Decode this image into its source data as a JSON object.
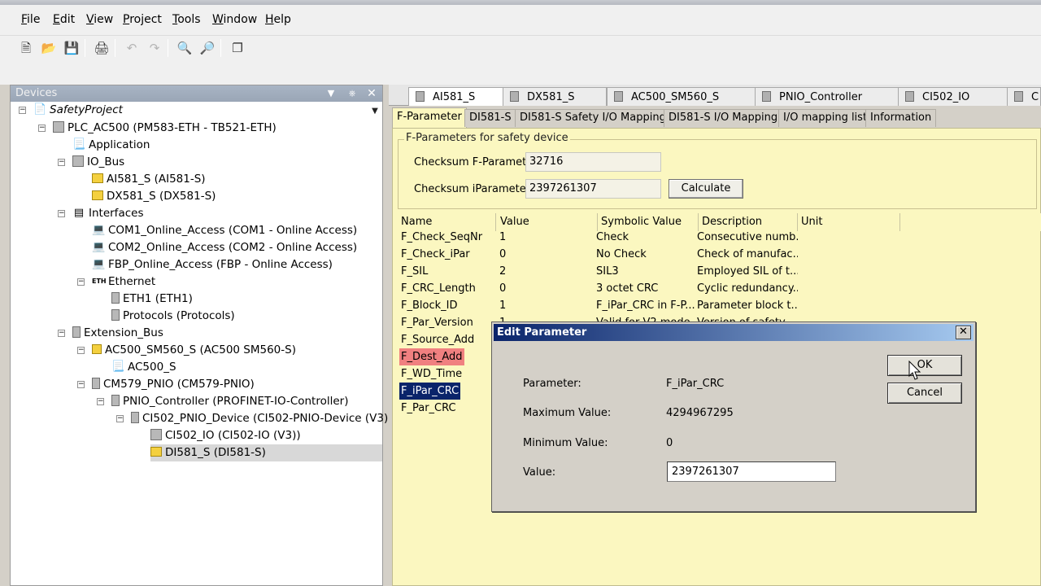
{
  "menu": [
    {
      "pre": "",
      "key": "F",
      "post": "ile"
    },
    {
      "pre": "",
      "key": "E",
      "post": "dit"
    },
    {
      "pre": "",
      "key": "V",
      "post": "iew"
    },
    {
      "pre": "",
      "key": "P",
      "post": "roject"
    },
    {
      "pre": "",
      "key": "T",
      "post": "ools"
    },
    {
      "pre": "",
      "key": "W",
      "post": "indow"
    },
    {
      "pre": "",
      "key": "H",
      "post": "elp"
    }
  ],
  "toolbar_icons": [
    "new-file-icon",
    "open-folder-icon",
    "save-icon",
    "print-icon",
    "undo-icon",
    "redo-icon",
    "find-icon",
    "find-replace-icon",
    "copy-window-icon"
  ],
  "devices": {
    "header": "Devices",
    "tree": [
      {
        "label": "SafetyProject",
        "italic": true
      },
      {
        "label": "PLC_AC500 (PM583-ETH - TB521-ETH)"
      },
      {
        "label": "Application"
      },
      {
        "label": "IO_Bus"
      },
      {
        "label": "AI581_S (AI581-S)"
      },
      {
        "label": "DX581_S (DX581-S)"
      },
      {
        "label": "Interfaces"
      },
      {
        "label": "COM1_Online_Access (COM1 - Online Access)"
      },
      {
        "label": "COM2_Online_Access (COM2 - Online Access)"
      },
      {
        "label": "FBP_Online_Access (FBP - Online Access)"
      },
      {
        "label": "Ethernet"
      },
      {
        "label": "ETH1 (ETH1)"
      },
      {
        "label": "Protocols (Protocols)"
      },
      {
        "label": "Extension_Bus"
      },
      {
        "label": "AC500_SM560_S (AC500 SM560-S)"
      },
      {
        "label": "AC500_S"
      },
      {
        "label": "CM579_PNIO (CM579-PNIO)"
      },
      {
        "label": "PNIO_Controller (PROFINET-IO-Controller)"
      },
      {
        "label": "CI502_PNIO_Device (CI502-PNIO-Device (V3))"
      },
      {
        "label": "CI502_IO (CI502-IO (V3))"
      },
      {
        "label": "DI581_S (DI581-S)",
        "selected": true
      }
    ]
  },
  "device_tabs": [
    "AI581_S",
    "DX581_S",
    "AC500_SM560_S",
    "PNIO_Controller",
    "CI502_IO",
    "C"
  ],
  "sub_tabs": [
    "F-Parameter",
    "DI581-S",
    "DI581-S Safety I/O Mapping",
    "DI581-S I/O Mapping",
    "I/O mapping list",
    "Information"
  ],
  "fparams": {
    "group_title": "F-Parameters for safety device",
    "checksum_f_label": "Checksum F-Parameter:",
    "checksum_f_value": "32716",
    "checksum_i_label": "Checksum iParameter:",
    "checksum_i_value": "2397261307",
    "calculate": "Calculate",
    "columns": [
      "Name",
      "Value",
      "Symbolic Value",
      "Description",
      "Unit"
    ],
    "rows": [
      {
        "name": "F_Check_SeqNr",
        "value": "1",
        "symbolic": "Check",
        "desc": "Consecutive numb..."
      },
      {
        "name": "F_Check_iPar",
        "value": "0",
        "symbolic": "No Check",
        "desc": "Check of manufac..."
      },
      {
        "name": "F_SIL",
        "value": "2",
        "symbolic": "SIL3",
        "desc": "Employed SIL of t..."
      },
      {
        "name": "F_CRC_Length",
        "value": "0",
        "symbolic": "3 octet CRC",
        "desc": "Cyclic redundancy..."
      },
      {
        "name": "F_Block_ID",
        "value": "1",
        "symbolic": "F_iPar_CRC in F-P...",
        "desc": "Parameter block t..."
      },
      {
        "name": "F_Par_Version",
        "value": "1",
        "symbolic": "Valid for V2 mode",
        "desc": "Version of safety..."
      },
      {
        "name": "F_Source_Add",
        "value": "",
        "symbolic": "",
        "desc": ""
      },
      {
        "name": "F_Dest_Add",
        "value": "",
        "symbolic": "",
        "desc": "",
        "highlight": "red"
      },
      {
        "name": "F_WD_Time",
        "value": "",
        "symbolic": "",
        "desc": ""
      },
      {
        "name": "F_iPar_CRC",
        "value": "",
        "symbolic": "",
        "desc": "",
        "highlight": "blue"
      },
      {
        "name": "F_Par_CRC",
        "value": "",
        "symbolic": "",
        "desc": ""
      }
    ]
  },
  "dialog": {
    "title": "Edit Parameter",
    "ok": "OK",
    "cancel": "Cancel",
    "param_label": "Parameter:",
    "param_value": "F_iPar_CRC",
    "max_label": "Maximum Value:",
    "max_value": "4294967295",
    "min_label": "Minimum Value:",
    "min_value": "0",
    "value_label": "Value:",
    "value": "2397261307"
  }
}
